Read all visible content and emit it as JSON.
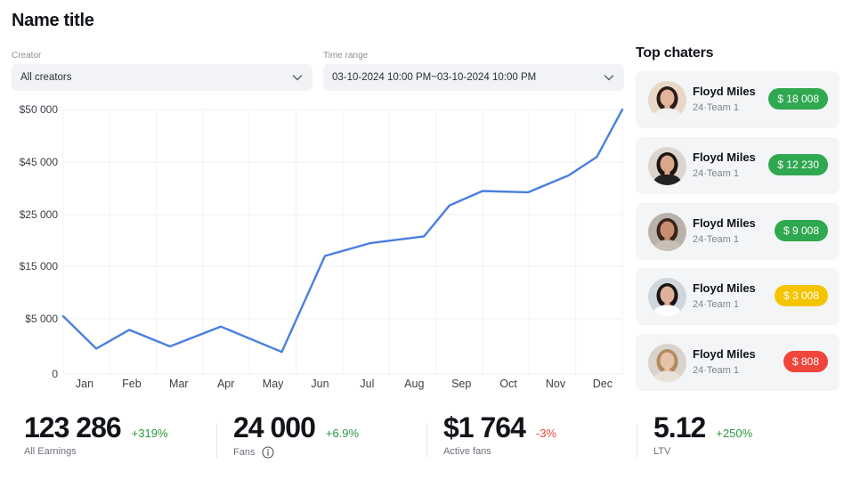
{
  "page": {
    "title": "Name title"
  },
  "filters": {
    "creator": {
      "label": "Creator",
      "value": "All creators"
    },
    "time_range": {
      "label": "Time range",
      "value": "03-10-2024 10:00 PM~03-10-2024 10:00 PM"
    }
  },
  "chart_data": {
    "type": "line",
    "categories": [
      "Jan",
      "Feb",
      "Mar",
      "Apr",
      "May",
      "Jun",
      "Jul",
      "Aug",
      "Sep",
      "Oct",
      "Nov",
      "Dec"
    ],
    "y_tick_labels": [
      "$50 000",
      "$45 000",
      "$25 000",
      "$15 000",
      "$5 000",
      "0"
    ],
    "y_tick_values": [
      50000,
      45000,
      25000,
      15000,
      5000,
      0
    ],
    "series": [
      {
        "color": "#4a7fe0",
        "x": [
          0,
          0.65,
          1.3,
          2.1,
          3.1,
          4.3,
          5.15,
          6.05,
          7.1,
          7.6,
          8.25,
          9.15,
          9.95,
          10.5,
          11.0
        ],
        "values": [
          5500,
          2300,
          4000,
          2500,
          4300,
          2000,
          17000,
          19500,
          20800,
          28500,
          34000,
          33500,
          40000,
          45500,
          50000
        ]
      }
    ],
    "grid": true,
    "legend": "none"
  },
  "top_chatters": {
    "title": "Top chaters",
    "items": [
      {
        "name": "Floyd Miles",
        "team": "24·Team 1",
        "amount": "$ 18 008",
        "color": "#2fa84f"
      },
      {
        "name": "Floyd Miles",
        "team": "24·Team 1",
        "amount": "$ 12 230",
        "color": "#2fa84f"
      },
      {
        "name": "Floyd Miles",
        "team": "24·Team 1",
        "amount": "$ 9 008",
        "color": "#2fa84f"
      },
      {
        "name": "Floyd Miles",
        "team": "24·Team 1",
        "amount": "$ 3 008",
        "color": "#f5c400"
      },
      {
        "name": "Floyd Miles",
        "team": "24·Team 1",
        "amount": "$ 808",
        "color": "#f0453a"
      }
    ]
  },
  "stats": [
    {
      "value": "123 286",
      "change": "+319%",
      "change_color": "#2a9a3e",
      "label": "All Earnings"
    },
    {
      "value": "24 000",
      "change": "+6.9%",
      "change_color": "#2a9a3e",
      "label": "Fans",
      "info_icon": "info-icon"
    },
    {
      "value": "$1 764",
      "change": "-3%",
      "change_color": "#e5453a",
      "label": "Active fans"
    },
    {
      "value": "5.12",
      "change": "+250%",
      "change_color": "#2a9a3e",
      "label": "LTV"
    }
  ]
}
